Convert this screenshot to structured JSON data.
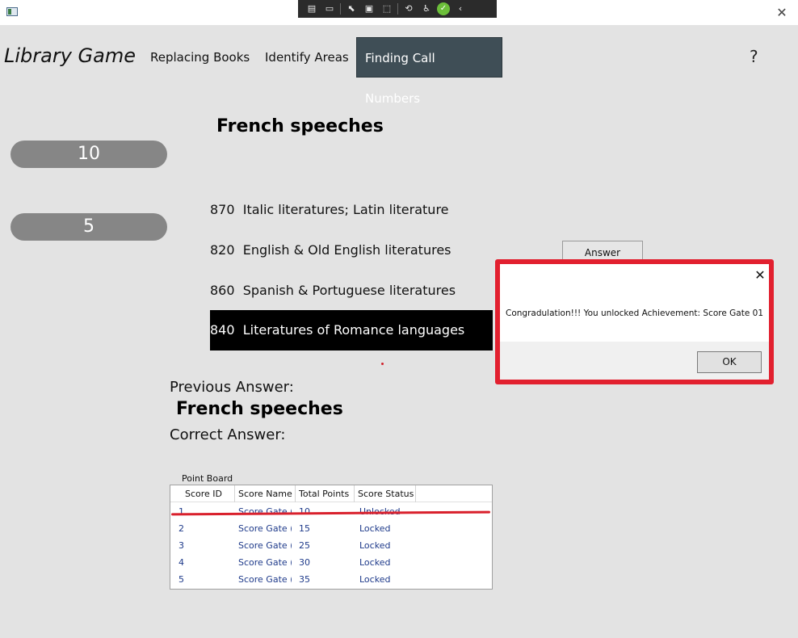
{
  "header": {
    "app_title": "Library Game",
    "nav": [
      "Replacing Books",
      "Identify Areas",
      "Finding Call Numbers"
    ],
    "active_nav": "Finding Call Numbers",
    "help": "?"
  },
  "debug_toolbar": {
    "icons": [
      "live-visual-tree-icon",
      "record-icon",
      "select-element-icon",
      "display-layout-icon",
      "track-focus-icon",
      "hot-reload-icon",
      "accessibility-icon",
      "status-ok-icon",
      "collapse-chevron-icon"
    ]
  },
  "scores": {
    "points": "10",
    "counter": "5"
  },
  "quiz": {
    "question": "French speeches",
    "options": [
      {
        "code": "870",
        "label": "Italic literatures; Latin literature"
      },
      {
        "code": "820",
        "label": "English & Old English literatures"
      },
      {
        "code": "860",
        "label": "Spanish & Portuguese literatures"
      },
      {
        "code": "840",
        "label": "Literatures of Romance languages"
      }
    ],
    "selected_code": "840",
    "answer_button": "Answer"
  },
  "previous": {
    "label": "Previous Answer:",
    "answer": "French speeches",
    "correct_label": "Correct Answer:",
    "correct_answer": ""
  },
  "point_board": {
    "title": "Point Board",
    "columns": [
      "Score ID",
      "Score Name",
      "Total Points",
      "Score Status"
    ],
    "rows": [
      {
        "id": "1",
        "name": "Score Gate (",
        "points": "10",
        "status": "Unlocked"
      },
      {
        "id": "2",
        "name": "Score Gate (",
        "points": "15",
        "status": "Locked"
      },
      {
        "id": "3",
        "name": "Score Gate (",
        "points": "25",
        "status": "Locked"
      },
      {
        "id": "4",
        "name": "Score Gate (",
        "points": "30",
        "status": "Locked"
      },
      {
        "id": "5",
        "name": "Score Gate (",
        "points": "35",
        "status": "Locked"
      }
    ]
  },
  "dialog": {
    "message": "Congradulation!!! You unlocked Achievement: Score Gate 01",
    "ok": "OK",
    "close": "✕"
  },
  "colors": {
    "background": "#e3e3e3",
    "nav_active": "#3f4e56",
    "pill": "#868686",
    "highlight_red": "#e2202f",
    "table_text": "#1e3a8a"
  }
}
